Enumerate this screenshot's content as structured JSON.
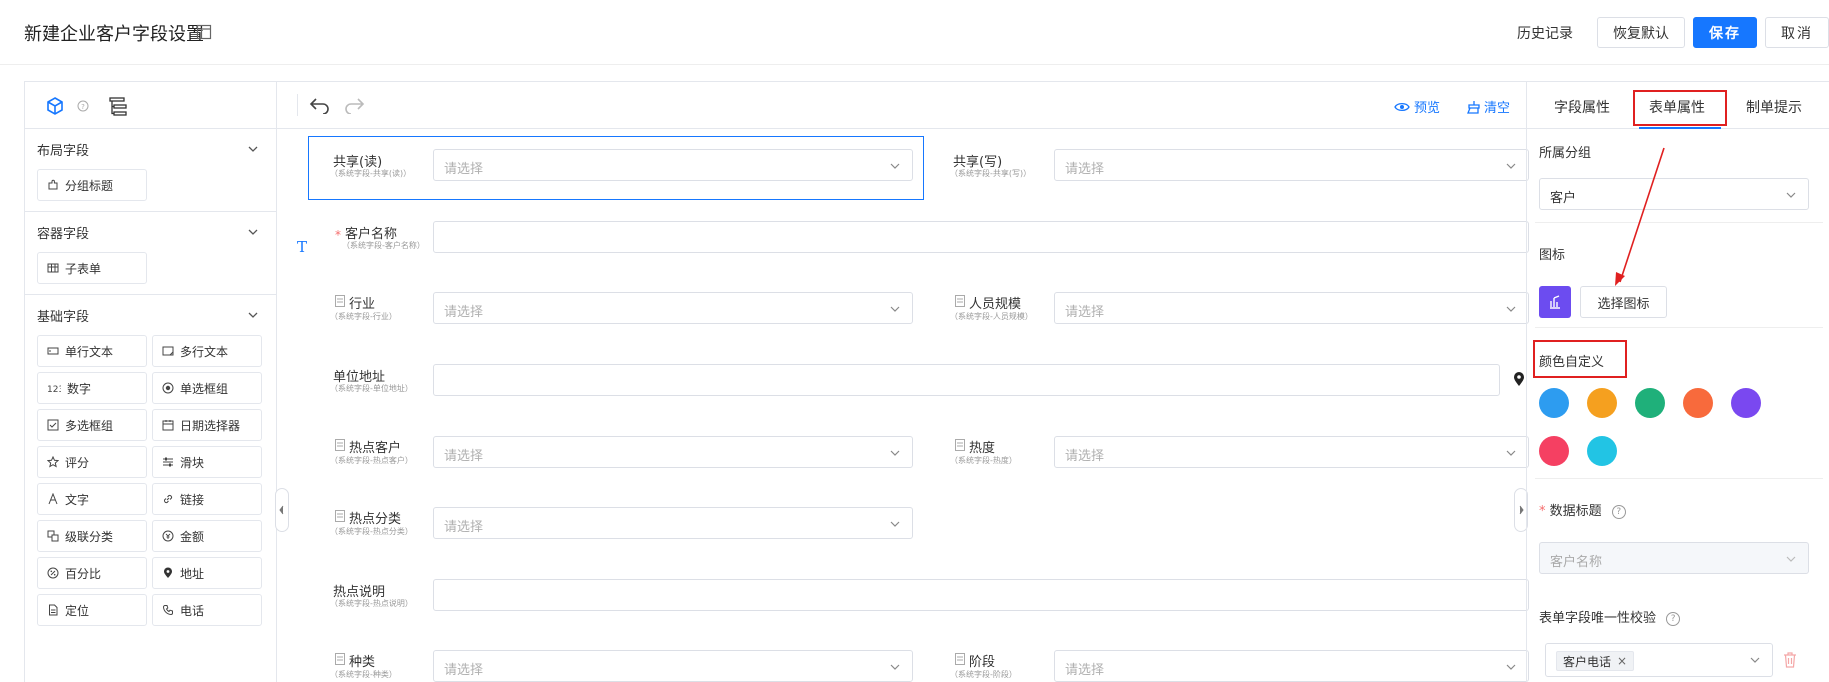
{
  "header": {
    "title": "新建企业客户字段设置",
    "history": "历史记录",
    "restore": "恢复默认",
    "save": "保存",
    "cancel": "取消"
  },
  "left_panel": {
    "sections": [
      {
        "title": "布局字段",
        "items": [
          "分组标题"
        ]
      },
      {
        "title": "容器字段",
        "items": [
          "子表单"
        ]
      },
      {
        "title": "基础字段",
        "items": [
          "单行文本",
          "多行文本",
          "数字",
          "单选框组",
          "多选框组",
          "日期选择器",
          "评分",
          "滑块",
          "文字",
          "链接",
          "级联分类",
          "金额",
          "百分比",
          "地址",
          "定位",
          "电话"
        ]
      }
    ],
    "number_icon_text": "123"
  },
  "toolbar": {
    "preview": "预览",
    "clear": "清空"
  },
  "form": {
    "placeholder": "请选择",
    "fields": [
      {
        "label": "共享(读)",
        "sub": "（系统字段-共享(读)）"
      },
      {
        "label": "共享(写)",
        "sub": "（系统字段-共享(写)）"
      },
      {
        "label": "客户名称",
        "sub": "（系统字段-客户名称）"
      },
      {
        "label": "行业",
        "sub": "（系统字段-行业）"
      },
      {
        "label": "人员规模",
        "sub": "（系统字段-人员规模）"
      },
      {
        "label": "单位地址",
        "sub": "（系统字段-单位地址）"
      },
      {
        "label": "热点客户",
        "sub": "（系统字段-热点客户）"
      },
      {
        "label": "热度",
        "sub": "（系统字段-热度）"
      },
      {
        "label": "热点分类",
        "sub": "（系统字段-热点分类）"
      },
      {
        "label": "热点说明",
        "sub": "（系统字段-热点说明）"
      },
      {
        "label": "种类",
        "sub": "（系统字段-种类）"
      },
      {
        "label": "阶段",
        "sub": "（系统字段-阶段）"
      }
    ],
    "required_mark": "*",
    "text_marker": "T"
  },
  "right_panel": {
    "tabs": [
      "字段属性",
      "表单属性",
      "制单提示"
    ],
    "group_label": "所属分组",
    "group_value": "客户",
    "icon_label": "图标",
    "choose_icon": "选择图标",
    "color_label": "颜色自定义",
    "colors": [
      "#2d9cf0",
      "#f5a01f",
      "#1fb07a",
      "#f86a3c",
      "#7a48f0",
      "#f54062",
      "#22c4e4"
    ],
    "data_title_label": "数据标题",
    "data_title_value": "客户名称",
    "unique_label": "表单字段唯一性校验",
    "unique_tag": "客户电话",
    "tag_close": "×",
    "help_mark": "?"
  }
}
